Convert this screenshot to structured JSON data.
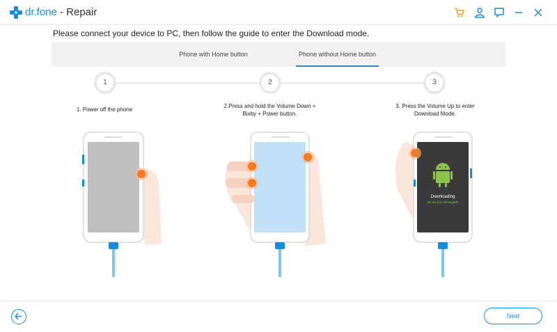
{
  "window": {
    "brand": "dr.fone",
    "title": "- Repair",
    "colors": {
      "accent": "#1a8bdc",
      "cart": "#f39c12"
    },
    "icons": [
      "cart-icon",
      "user-icon",
      "feedback-icon",
      "minimize-icon",
      "close-icon"
    ]
  },
  "instruction": "Please connect your device to PC, then follow the guide to enter the Download mode.",
  "tabs": [
    {
      "label": "Phone with Home button",
      "active": false
    },
    {
      "label": "Phone without Home button",
      "active": true
    }
  ],
  "steps": [
    {
      "number": "1",
      "line1": "1. Power off the phone",
      "line2": ""
    },
    {
      "number": "2",
      "line1": "2.Press and hold the Volume Down +",
      "line2": "Bixby + Power button."
    },
    {
      "number": "3",
      "line1": "3. Press the Volume Up to enter",
      "line2": "Download Mode."
    }
  ],
  "phone3": {
    "status": "Downloading",
    "warning": "Do not turn off target!!!"
  },
  "footer": {
    "next_label": "Next"
  }
}
